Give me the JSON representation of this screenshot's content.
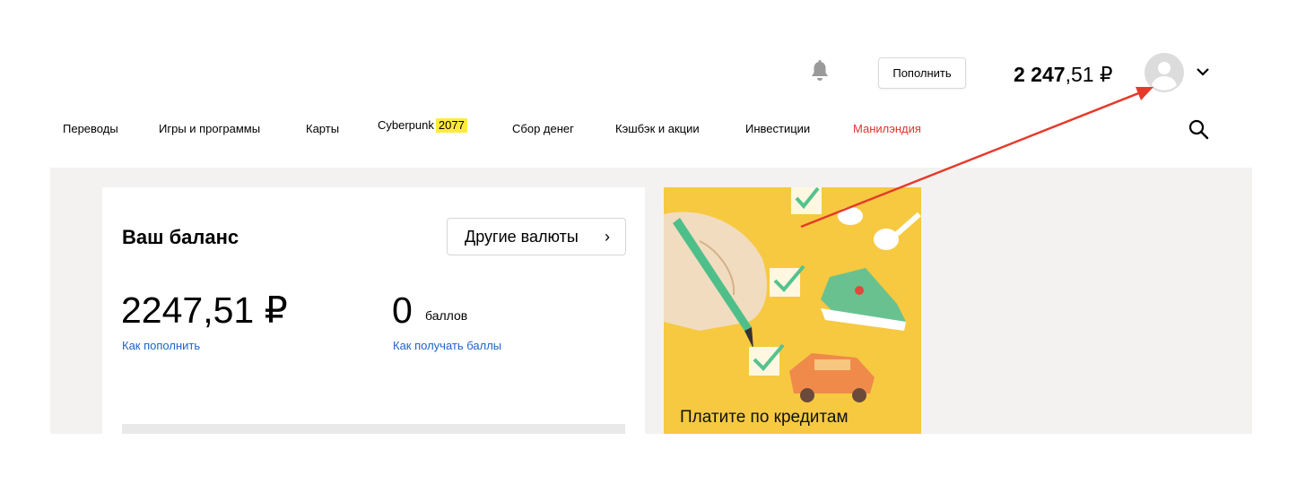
{
  "header": {
    "topup_label": "Пополнить",
    "balance_int": "2 247",
    "balance_frac": ",51 ₽"
  },
  "nav": {
    "items": [
      {
        "label": "Переводы"
      },
      {
        "label": "Игры и программы"
      },
      {
        "label": "Карты"
      },
      {
        "label": "Cyberpunk",
        "badge": "2077"
      },
      {
        "label": "Сбор денег"
      },
      {
        "label": "Кэшбэк и акции"
      },
      {
        "label": "Инвестиции"
      },
      {
        "label": "Манилэндия"
      }
    ]
  },
  "balance_card": {
    "title": "Ваш баланс",
    "currencies_label": "Другие валюты",
    "currencies_arrow": "›",
    "amount": "2247,51 ₽",
    "howto_topup": "Как пополнить",
    "points_value": "0",
    "points_label": "баллов",
    "howto_points": "Как получать баллы"
  },
  "promo": {
    "text": "Платите по кредитам кошельком"
  },
  "icons": {
    "bell": "bell-icon",
    "avatar": "user-avatar-icon",
    "chevron": "chevron-down-icon",
    "search": "search-icon"
  },
  "colors": {
    "link": "#1e63c9",
    "nav_highlight": "#e0342b",
    "badge": "#ffeb3b",
    "promo_bg": "#f6c941",
    "content_bg": "#f3f2f0",
    "annotation": "#e53a2a"
  }
}
